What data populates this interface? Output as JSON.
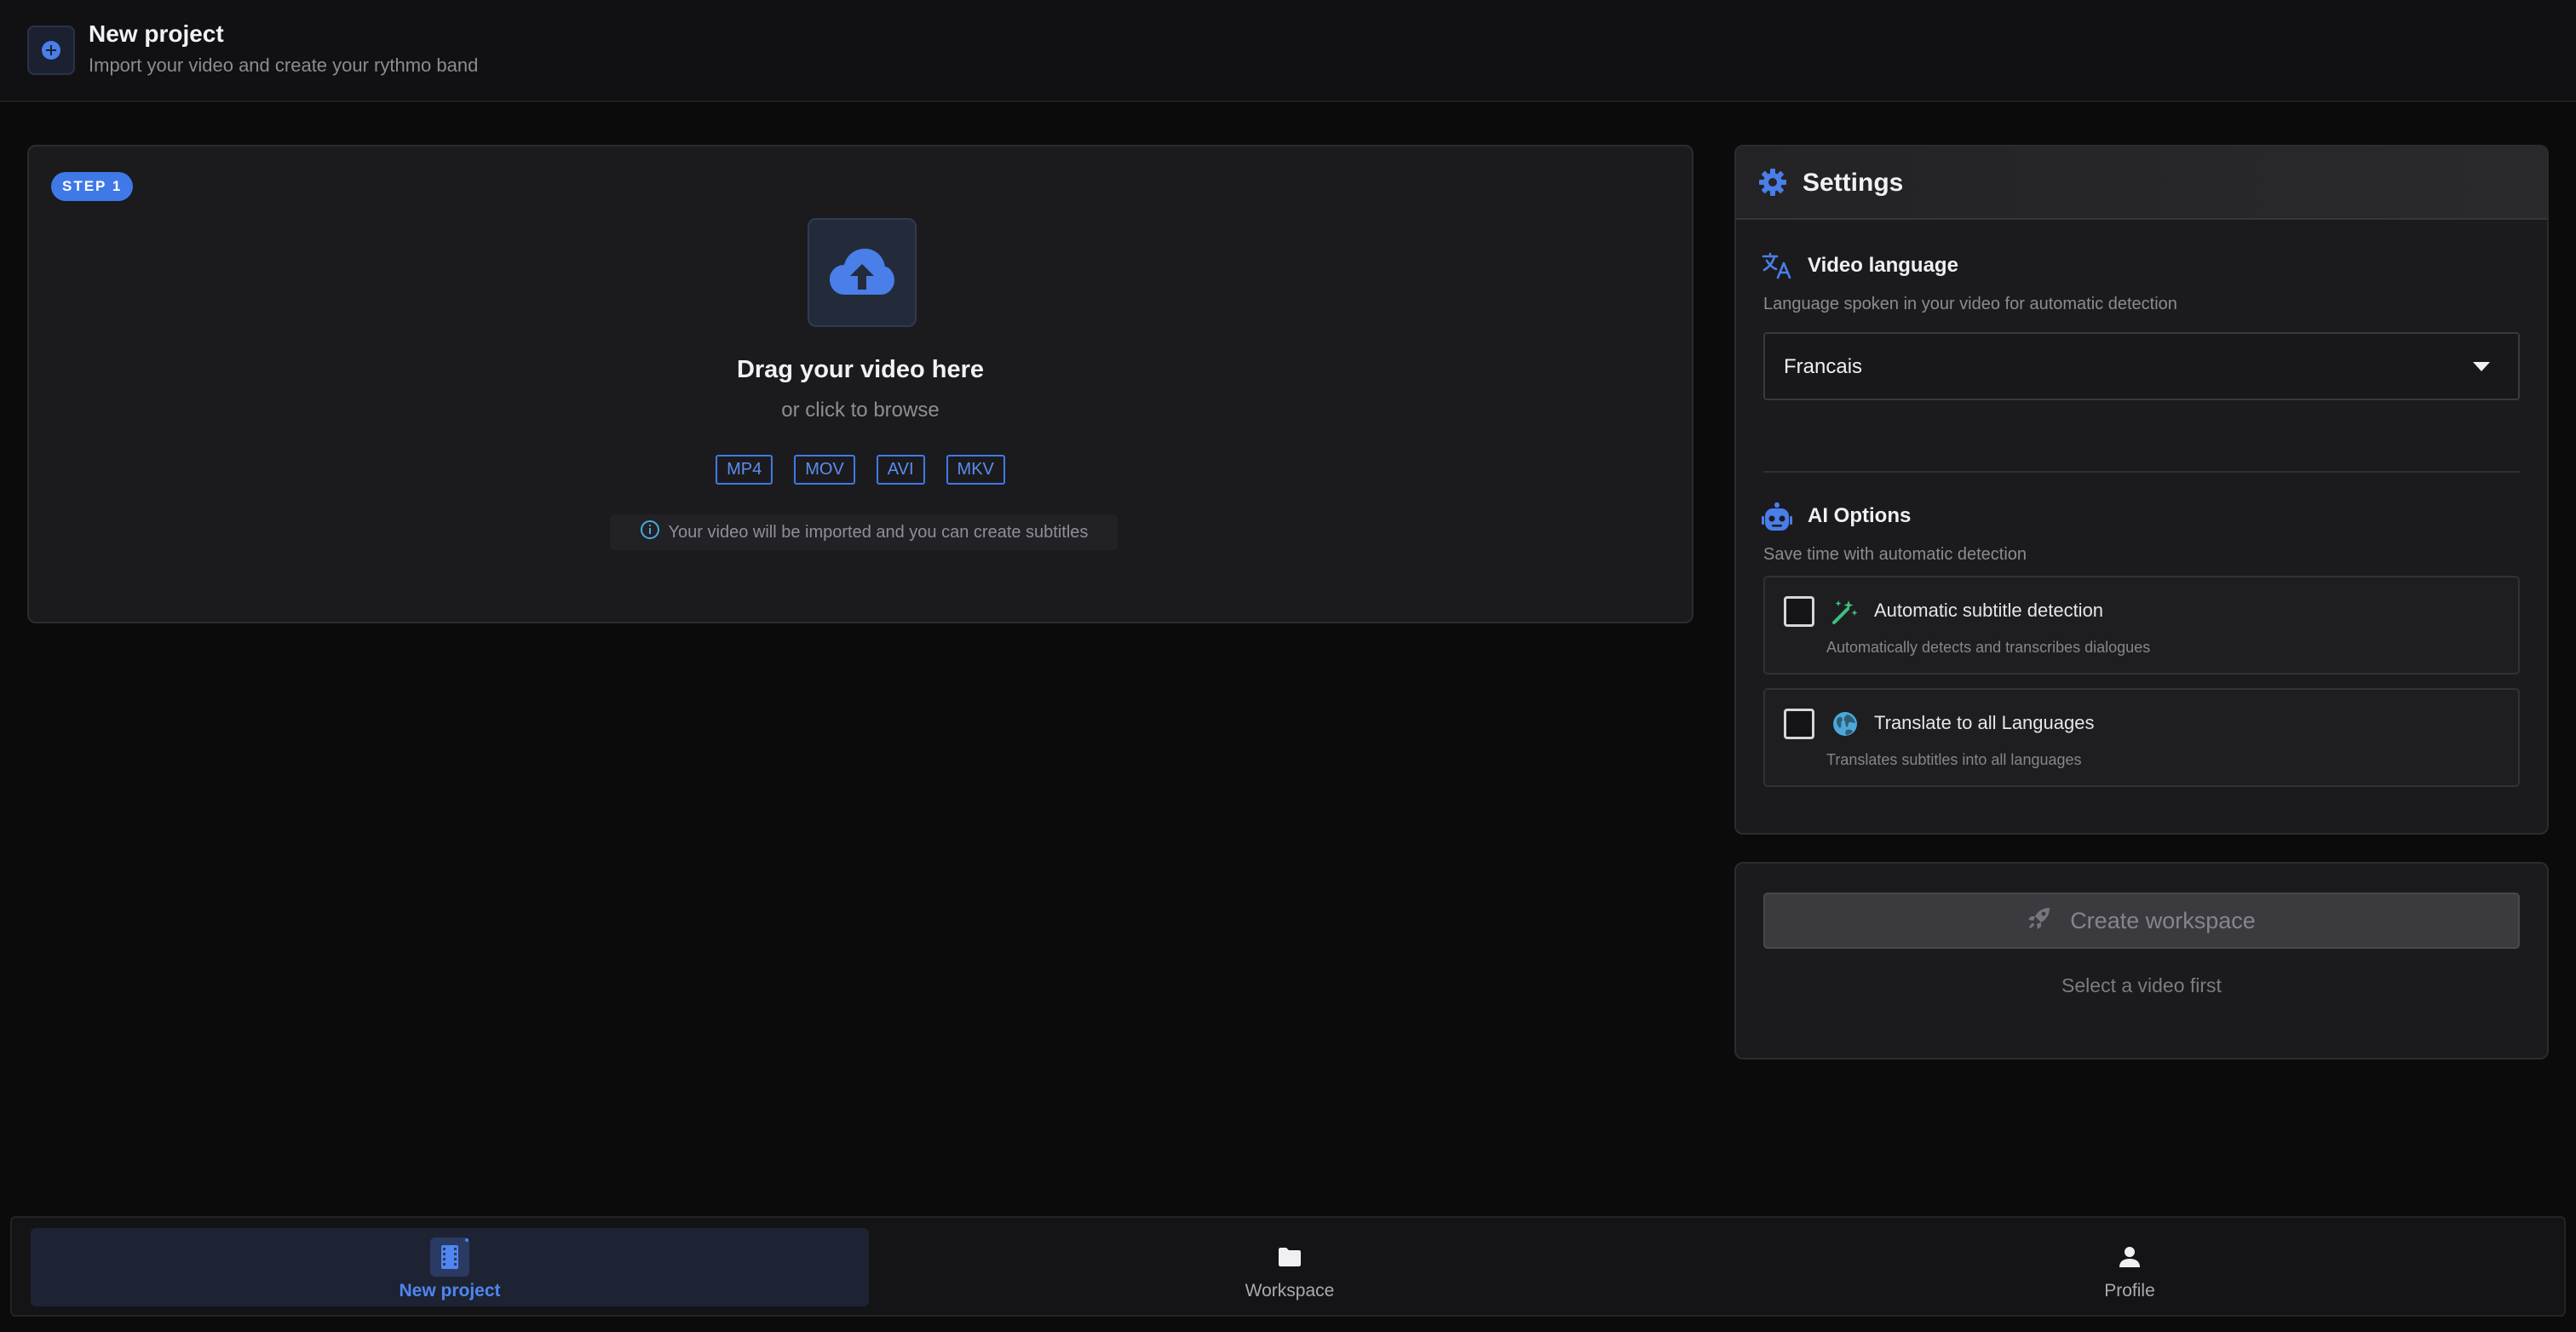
{
  "header": {
    "title": "New project",
    "subtitle": "Import your video and create your rythmo band",
    "icon": "plus-circle-icon"
  },
  "upload": {
    "step_badge": "STEP 1",
    "title": "Drag your video here",
    "subtitle": "or click to browse",
    "formats": [
      "MP4",
      "MOV",
      "AVI",
      "MKV"
    ],
    "info": "Your video will be imported and you can create subtitles"
  },
  "settings": {
    "title": "Settings",
    "video_language": {
      "title": "Video language",
      "description": "Language spoken in your video for automatic detection",
      "selected": "Francais"
    },
    "ai_options": {
      "title": "AI Options",
      "description": "Save time with automatic detection",
      "options": [
        {
          "label": "Automatic subtitle detection",
          "description": "Automatically detects and transcribes dialogues",
          "icon": "magic-wand-icon",
          "checked": false
        },
        {
          "label": "Translate to all Languages",
          "description": "Translates subtitles into all languages",
          "icon": "globe-icon",
          "checked": false
        }
      ]
    }
  },
  "create": {
    "button_label": "Create workspace",
    "hint": "Select a video first"
  },
  "nav": {
    "items": [
      {
        "label": "New project",
        "icon": "film-icon",
        "active": true
      },
      {
        "label": "Workspace",
        "icon": "folder-icon",
        "active": false
      },
      {
        "label": "Profile",
        "icon": "person-icon",
        "active": false
      }
    ]
  },
  "colors": {
    "accent": "#3f79e8",
    "background": "#0b0b0c",
    "panel": "#1b1b1e"
  }
}
